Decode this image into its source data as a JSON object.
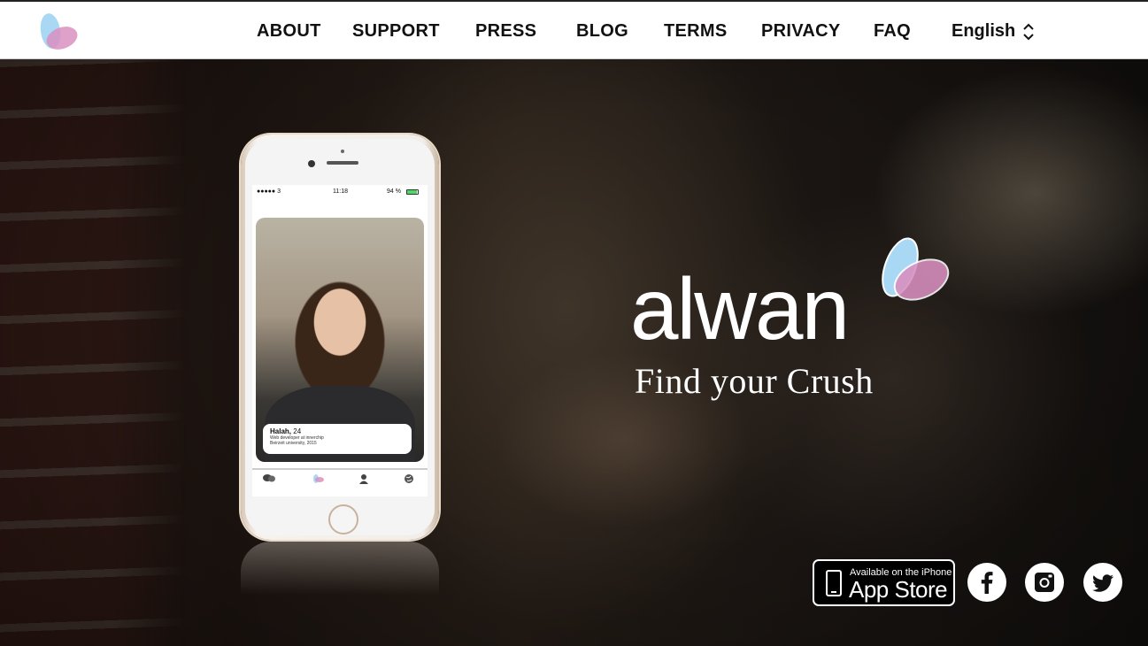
{
  "nav": {
    "items": [
      {
        "label": "ABOUT"
      },
      {
        "label": "SUPPORT"
      },
      {
        "label": "PRESS"
      },
      {
        "label": "BLOG"
      },
      {
        "label": "TERMS"
      },
      {
        "label": "PRIVACY"
      },
      {
        "label": "FAQ"
      }
    ],
    "language": "English"
  },
  "hero": {
    "brand_name": "alwan",
    "tagline": "Find your Crush"
  },
  "phone": {
    "status": {
      "carrier": "●●●●● 3",
      "time": "11:18",
      "battery": "94 %"
    },
    "battery_level": 0.94,
    "profile": {
      "name": "Halah,",
      "age": "24",
      "line1": "Web developer at innerchip",
      "line2": "Beirzeit university, 2015"
    }
  },
  "appstore": {
    "line1": "Available on the iPhone",
    "line2": "App Store"
  },
  "social": [
    "facebook-icon",
    "instagram-icon",
    "twitter-icon"
  ],
  "colors": {
    "heart_blue": "#a8d8f4",
    "heart_pink": "#d98fc0",
    "heart_overlap": "#c0a9d8",
    "battery_green": "#4cd964"
  }
}
